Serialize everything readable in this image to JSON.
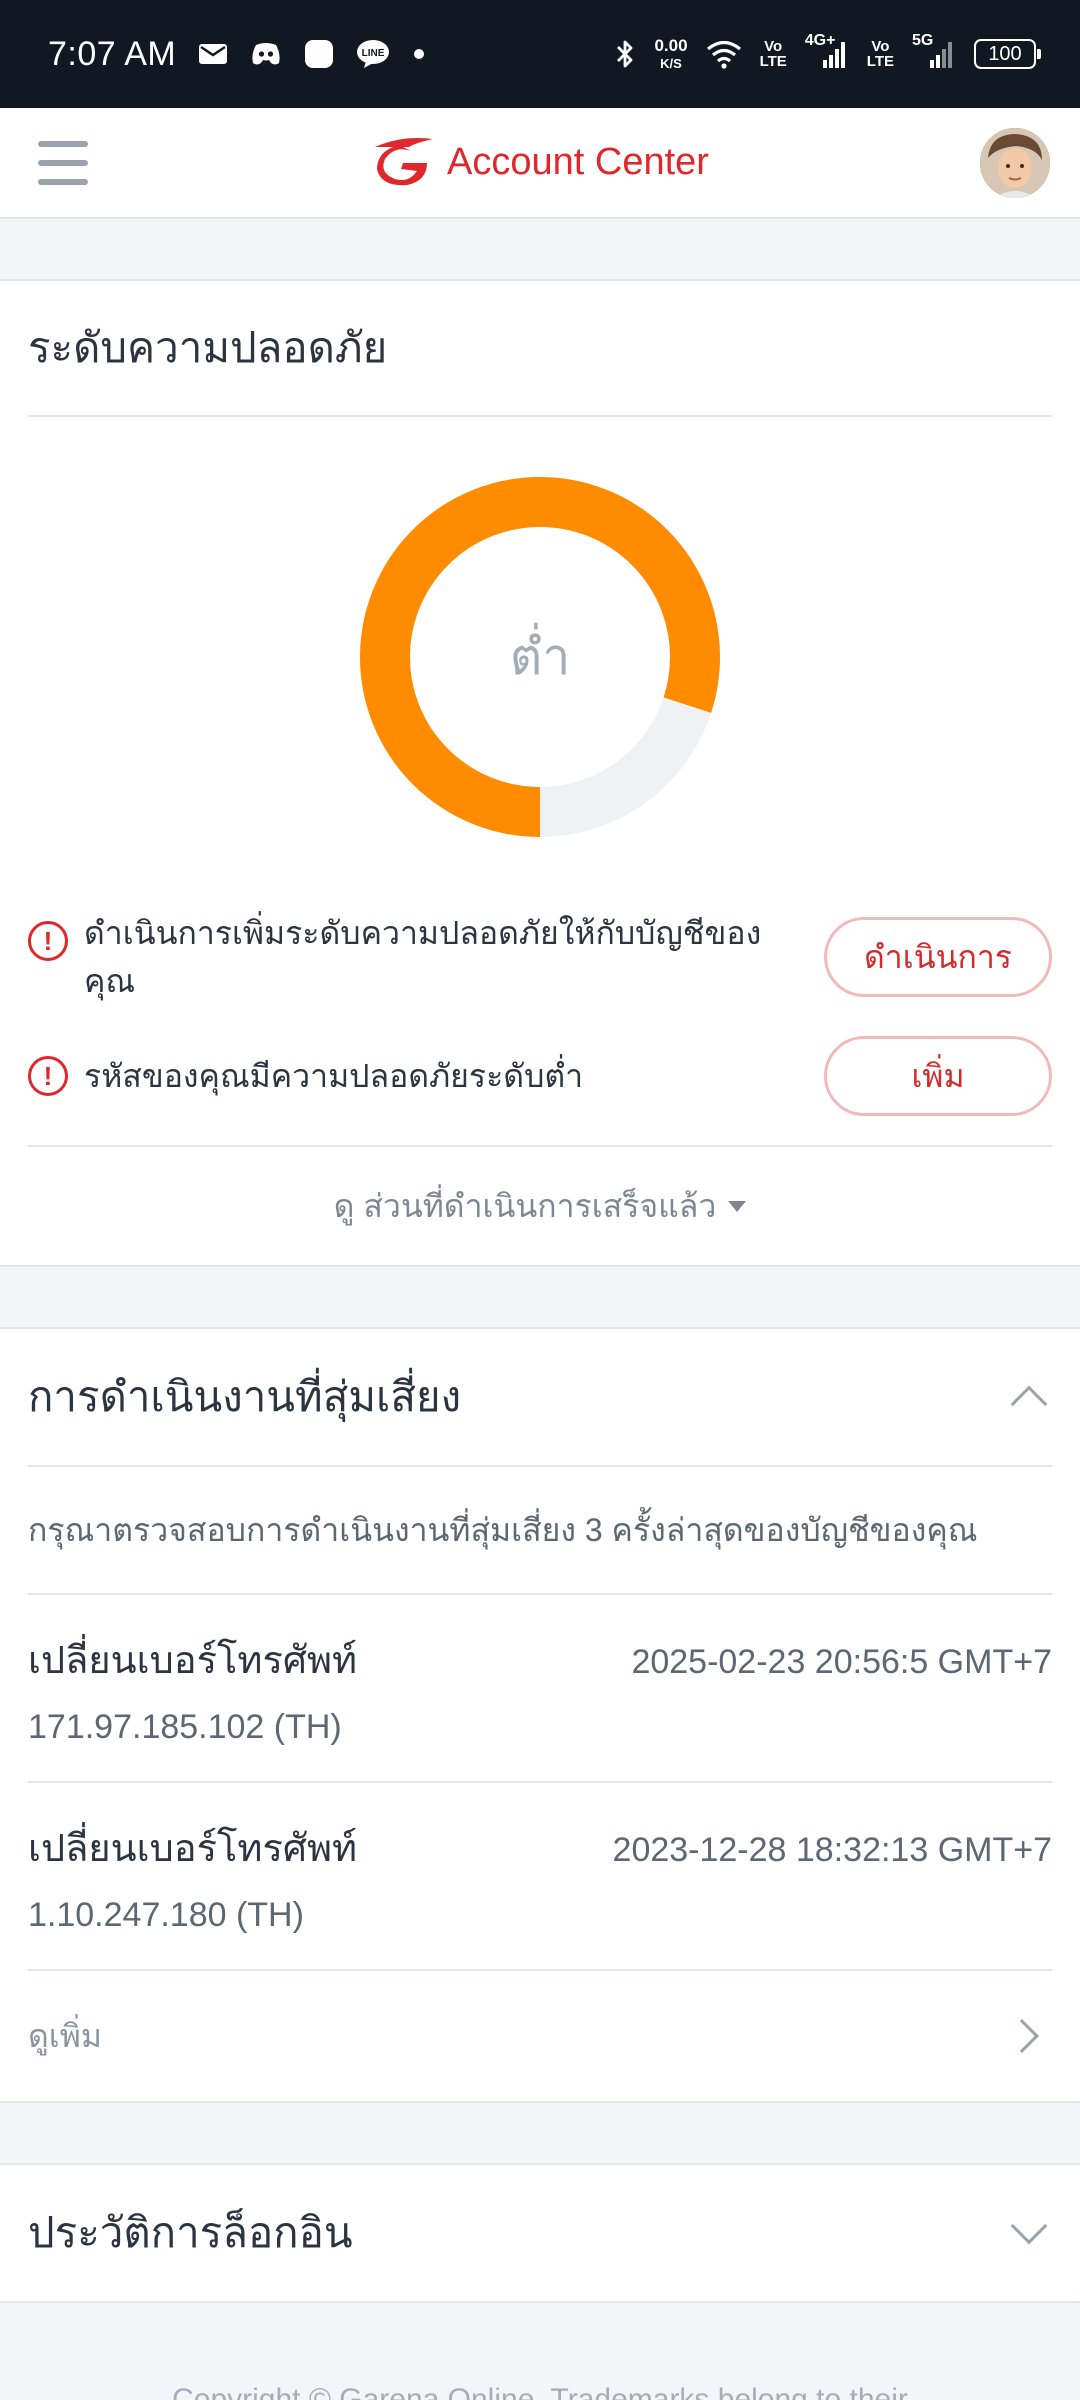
{
  "status_bar": {
    "time": "7:07 AM",
    "notification_icons": [
      "mail-icon",
      "discord-icon",
      "app-icon",
      "line-icon",
      "dot-icon"
    ],
    "net_speed_value": "0.00",
    "net_speed_unit": "K/S",
    "sim1_label_top": "Vo",
    "sim1_label_bottom": "LTE",
    "sim1_network": "4G+",
    "sim2_label_top": "Vo",
    "sim2_label_bottom": "LTE",
    "sim2_network": "5G",
    "battery": "100"
  },
  "header": {
    "title": "Account Center",
    "brand_color": "#e0272b"
  },
  "security": {
    "title": "ระดับความปลอดภัย",
    "level_label": "ต่ำ",
    "level_fraction": 0.8,
    "accent_color": "#ff8c00",
    "track_color": "#eef2f5",
    "actions": [
      {
        "text": "ดำเนินการเพิ่มระดับความปลอดภัยให้กับบัญชีของคุณ",
        "button": "ดำเนินการ"
      },
      {
        "text": "รหัสของคุณมีความปลอดภัยระดับต่ำ",
        "button": "เพิ่ม"
      }
    ],
    "see_done": "ดู ส่วนที่ดำเนินการเสร็จแล้ว"
  },
  "risky": {
    "title": "การดำเนินงานที่สุ่มเสี่ยง",
    "description": "กรุณาตรวจสอบการดำเนินงานที่สุ่มเสี่ยง 3 ครั้งล่าสุดของบัญชีของคุณ",
    "operations": [
      {
        "name": "เปลี่ยนเบอร์โทรศัพท์",
        "time": "2025-02-23 20:56:5 GMT+7",
        "ip": "171.97.185.102 (TH)"
      },
      {
        "name": "เปลี่ยนเบอร์โทรศัพท์",
        "time": "2023-12-28 18:32:13 GMT+7",
        "ip": "1.10.247.180 (TH)"
      }
    ],
    "see_more": "ดูเพิ่ม"
  },
  "login_history": {
    "title": "ประวัติการล็อกอิน"
  },
  "footer": {
    "copyright": "Copyright © Garena Online. Trademarks belong to their"
  }
}
